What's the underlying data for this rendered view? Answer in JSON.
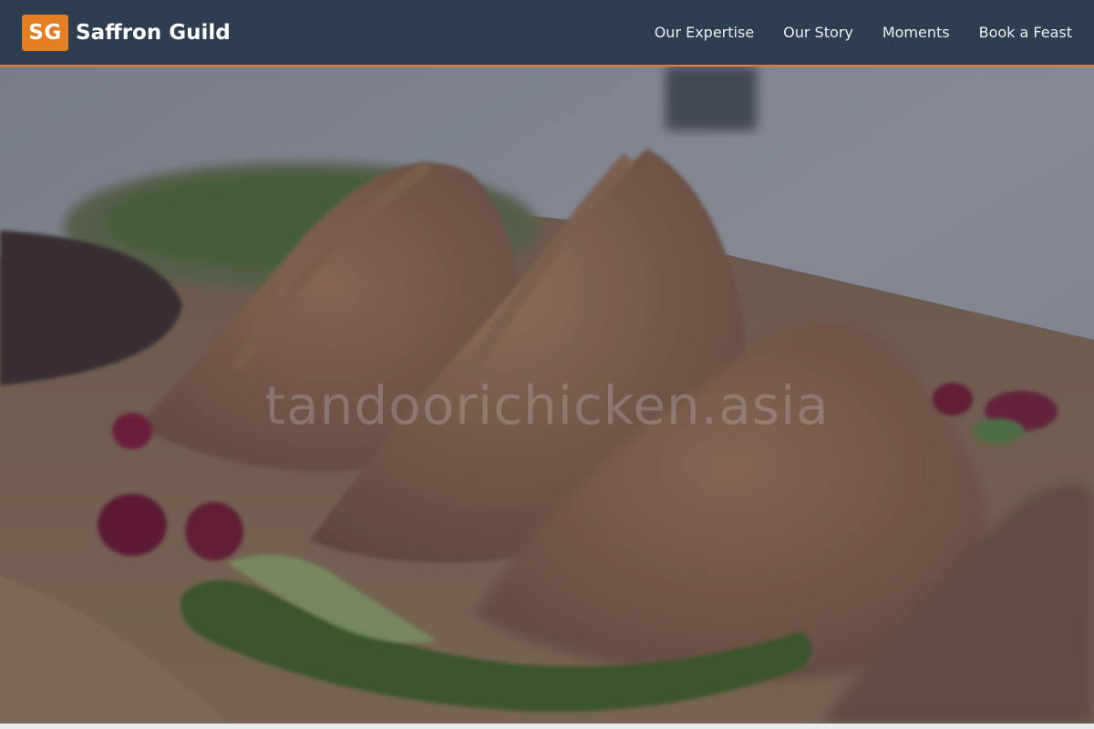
{
  "brand": {
    "logo_text": "SG",
    "name": "Saffron Guild"
  },
  "nav": {
    "items": [
      {
        "label": "Our Expertise"
      },
      {
        "label": "Our Story"
      },
      {
        "label": "Moments"
      },
      {
        "label": "Book a Feast"
      }
    ]
  },
  "hero": {
    "image_subject": "samosas with chutney, pomegranate seeds and green chili on a wooden board",
    "watermark": "tandoorichicken.asia"
  },
  "colors": {
    "navbar_bg": "#2c3e50",
    "accent": "#e67e22",
    "nav_text": "#ecf0f1"
  }
}
